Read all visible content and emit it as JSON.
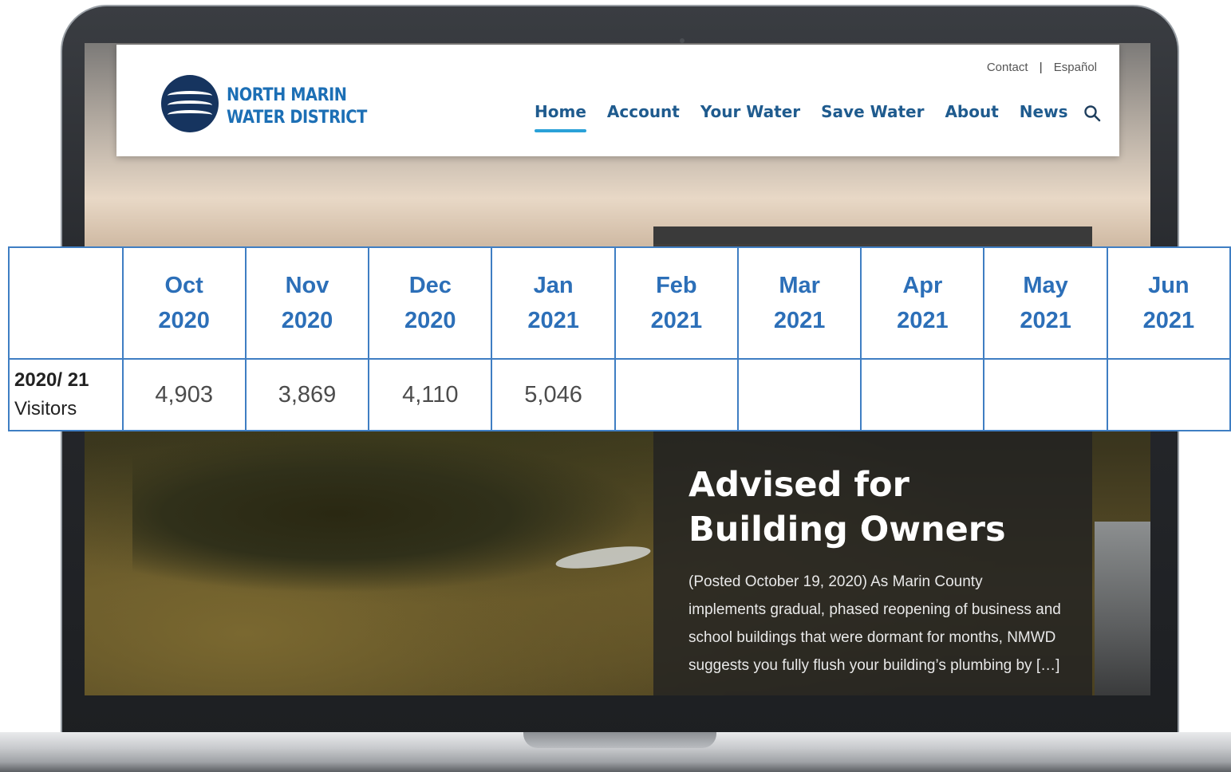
{
  "site": {
    "logo_line1": "NORTH MARIN",
    "logo_line2": "WATER DISTRICT",
    "utility_nav": {
      "contact": "Contact",
      "separator": "|",
      "espanol": "Español"
    },
    "main_nav": [
      "Home",
      "Account",
      "Your Water",
      "Save Water",
      "About",
      "News"
    ],
    "active_nav": "Home",
    "colors": {
      "brand_blue": "#1c6fb5",
      "nav_text": "#1f5b8e",
      "active_underline": "#2aa1d8",
      "logo_navy": "#16345f"
    }
  },
  "news": {
    "title_line1": "Advised for",
    "title_line2": "Building Owners",
    "body": "(Posted October 19, 2020)  As Marin County implements gradual, phased reopening of business and school buildings that were dormant for months,  NMWD suggests you fully flush your building’s plumbing by […]"
  },
  "visitors_table": {
    "columns": [
      {
        "month": "Oct",
        "year": "2020"
      },
      {
        "month": "Nov",
        "year": "2020"
      },
      {
        "month": "Dec",
        "year": "2020"
      },
      {
        "month": "Jan",
        "year": "2021"
      },
      {
        "month": "Feb",
        "year": "2021"
      },
      {
        "month": "Mar",
        "year": "2021"
      },
      {
        "month": "Apr",
        "year": "2021"
      },
      {
        "month": "May",
        "year": "2021"
      },
      {
        "month": "Jun",
        "year": "2021"
      }
    ],
    "row_label_year": "2020/ 21",
    "row_label_sub": "Visitors",
    "values": [
      "4,903",
      "3,869",
      "4,110",
      "5,046",
      "",
      "",
      "",
      "",
      ""
    ],
    "colors": {
      "border": "#3f7ec3",
      "header_text": "#2c6fb8"
    }
  }
}
